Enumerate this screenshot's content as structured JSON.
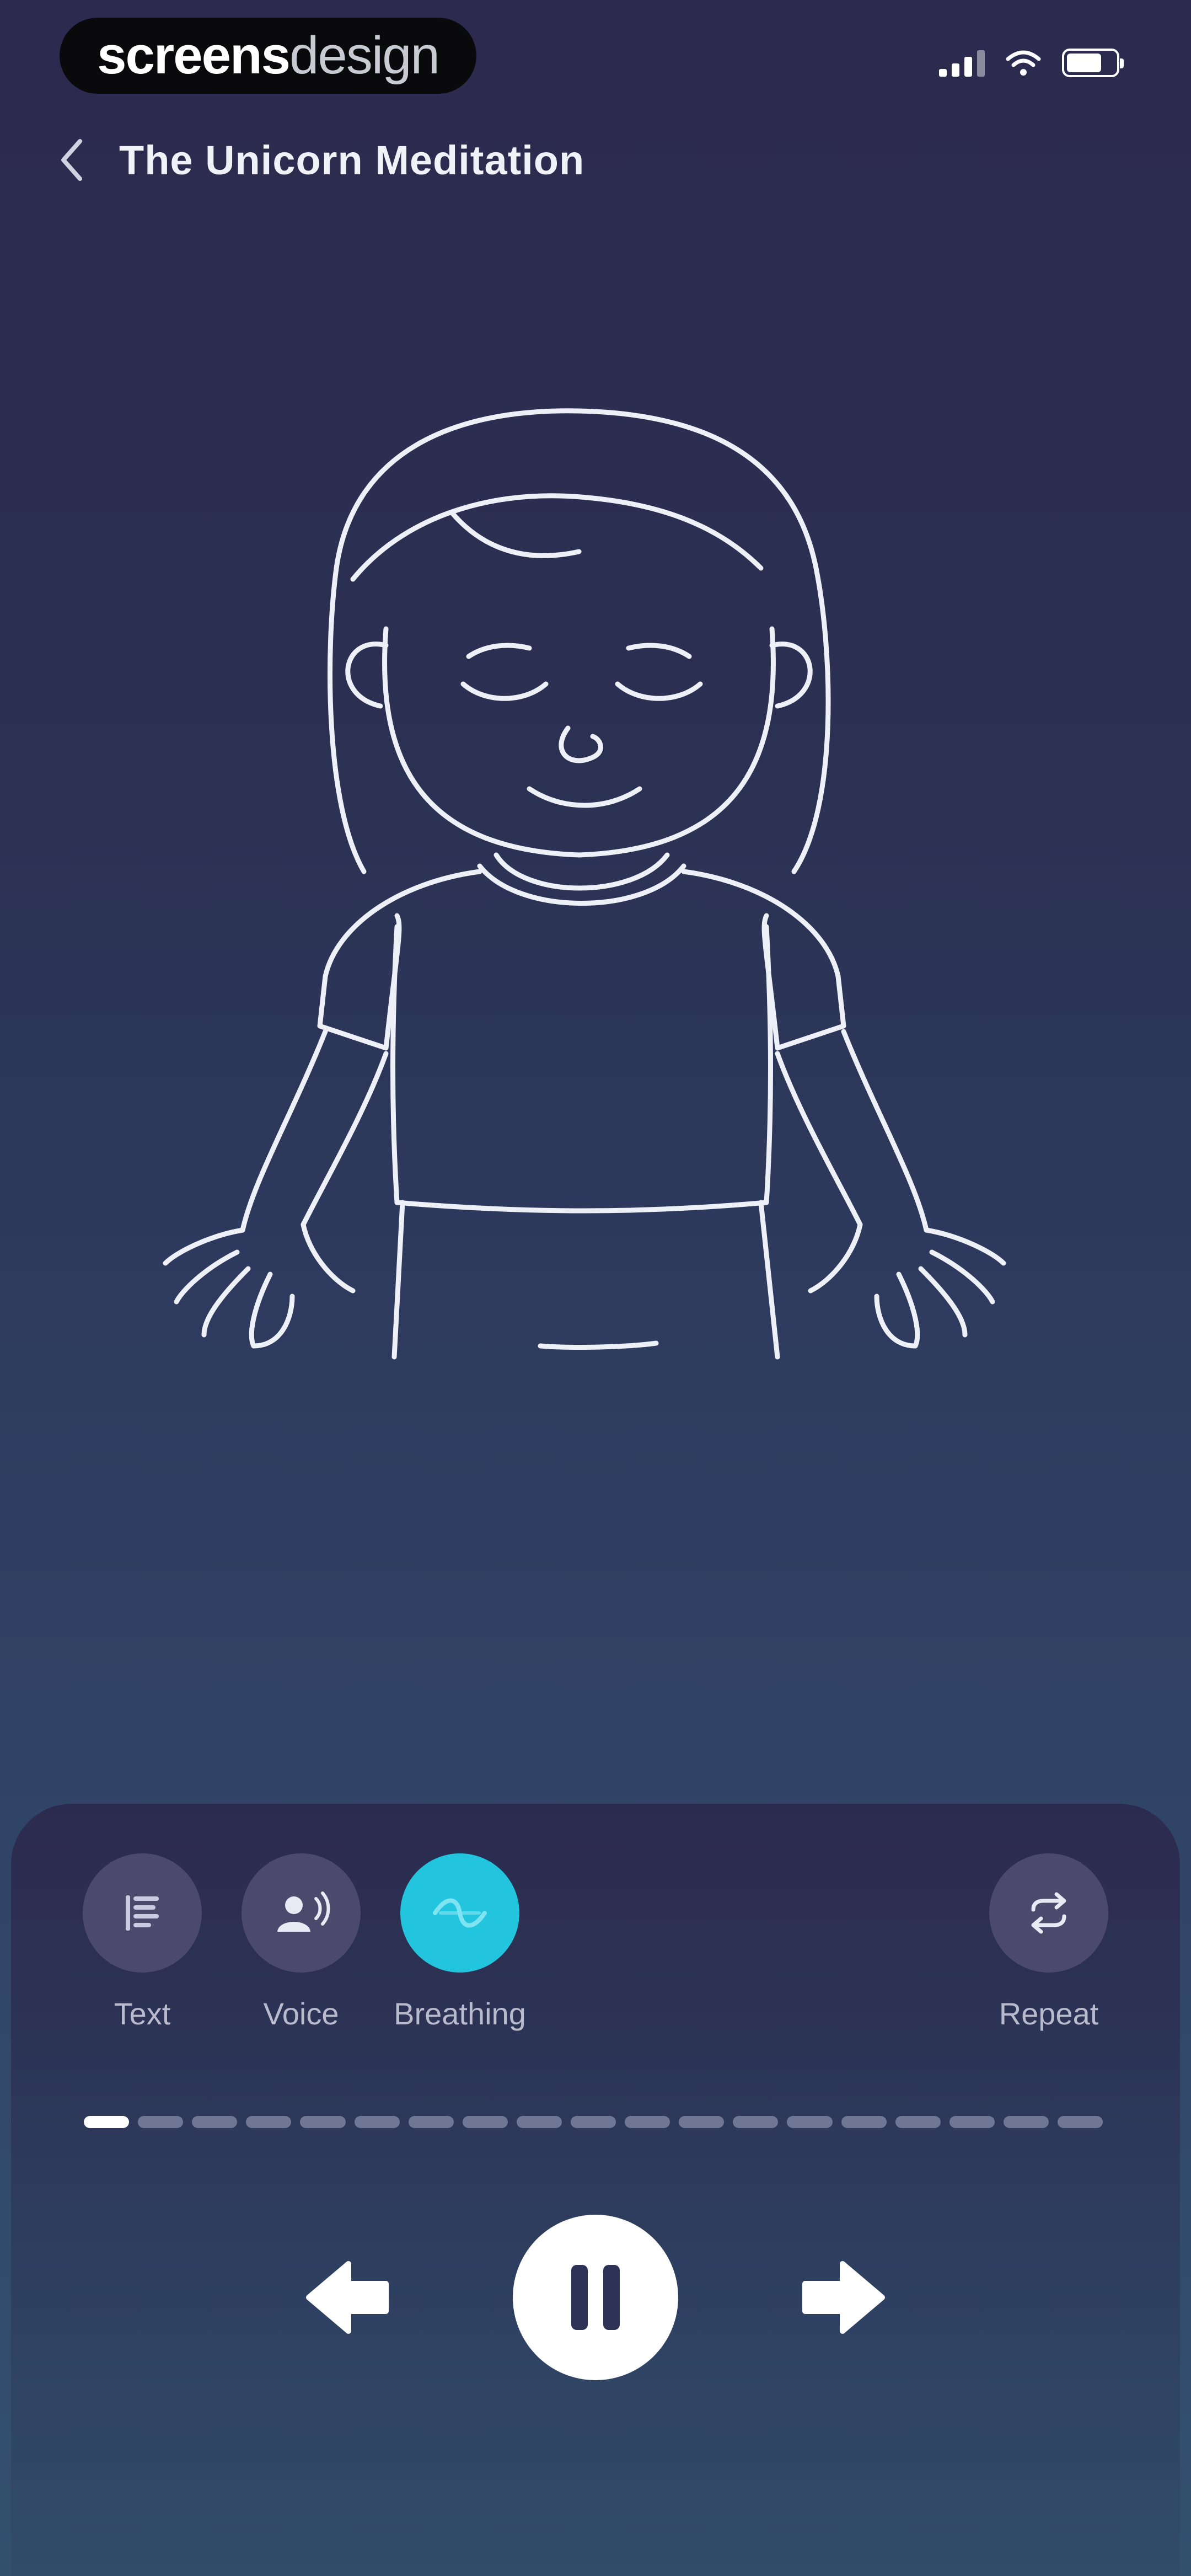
{
  "status_bar": {
    "brand_primary": "screens",
    "brand_secondary": "design"
  },
  "header": {
    "back_icon": "chevron-left-icon",
    "title": "The Unicorn Meditation"
  },
  "illustration": {
    "subject": "girl-meditating-line-art"
  },
  "modes": [
    {
      "label": "Text",
      "icon": "text-lines-icon",
      "active": false
    },
    {
      "label": "Voice",
      "icon": "person-voice-icon",
      "active": false
    },
    {
      "label": "Breathing",
      "icon": "breathing-wave-icon",
      "active": true
    },
    {
      "label": "Repeat",
      "icon": "repeat-icon",
      "active": false
    }
  ],
  "progress": {
    "total_steps": 19,
    "completed_steps": 1
  },
  "controls": {
    "previous_icon": "arrow-left-icon",
    "pause_icon": "pause-icon",
    "next_icon": "arrow-right-icon"
  },
  "colors": {
    "accent": "#22c4de",
    "background_top": "#2c2a4e",
    "background_bottom": "#33506f",
    "mode_button": "#4b4a6c"
  }
}
